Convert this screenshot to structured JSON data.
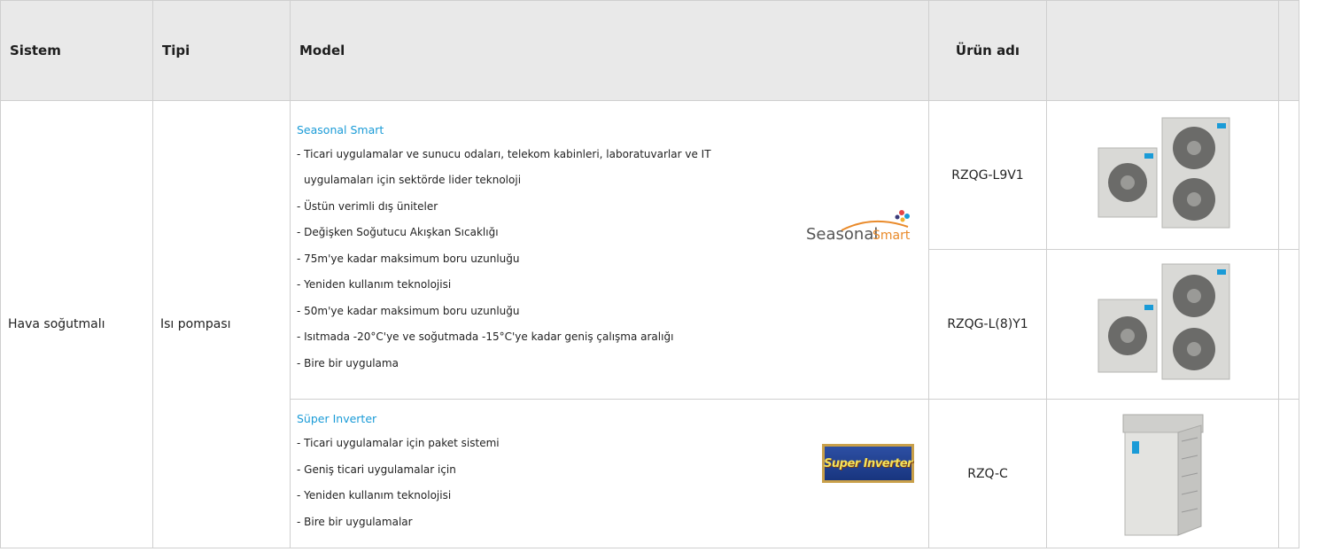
{
  "header": {
    "col_sistem": "Sistem",
    "col_tipi": "Tipi",
    "col_model": "Model",
    "col_urun_adi": "Ürün adı",
    "col_image": ""
  },
  "row": {
    "sistem": "Hava soğutmalı",
    "tipi": "Isı pompası"
  },
  "models": [
    {
      "title": "Seasonal Smart",
      "logo_text_1": "Seasonal",
      "logo_text_2": "Smart",
      "features": [
        "- Ticari uygulamalar ve sunucu odaları, telekom kabinleri, laboratuvarlar ve IT",
        "uygulamaları için sektörde lider teknoloji",
        "- Üstün verimli dış üniteler",
        "- Değişken Soğutucu Akışkan Sıcaklığı",
        "- 75m'ye kadar maksimum boru uzunluğu",
        "- Yeniden kullanım teknolojisi",
        "- 50m'ye kadar maksimum boru uzunluğu",
        "- Isıtmada -20°C'ye ve soğutmada -15°C'ye kadar geniş çalışma aralığı",
        "- Bire bir uygulama"
      ],
      "products": [
        "RZQG-L9V1",
        "RZQG-L(8)Y1"
      ]
    },
    {
      "title": "Süper Inverter",
      "logo_text": "Super Inverter",
      "features": [
        "- Ticari uygulamalar için paket sistemi",
        "- Geniş ticari uygulamalar için",
        "- Yeniden kullanım teknolojisi",
        "- Bire bir uygulamalar"
      ],
      "products": [
        "RZQ-C"
      ]
    }
  ],
  "colors": {
    "header_bg": "#e9e9e9",
    "accent_blue": "#1a9bd7",
    "border": "#cfcfcf"
  }
}
